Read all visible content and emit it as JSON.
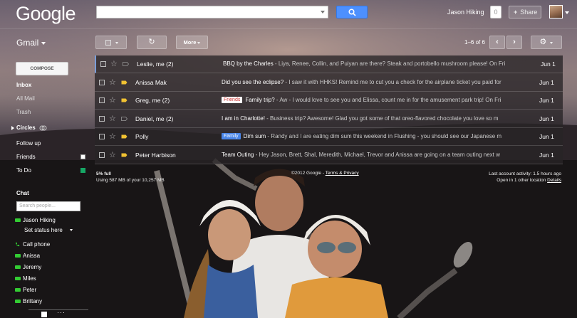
{
  "app": {
    "logo": "Google",
    "product": "Gmail"
  },
  "header": {
    "search": {
      "value": "",
      "placeholder": ""
    },
    "user_name": "Jason Hiking",
    "notifications_count": "0",
    "share_label": "Share",
    "share_plus": "+"
  },
  "toolbar": {
    "more_label": "More",
    "pager": "1–6 of 6",
    "prev_glyph": "‹",
    "next_glyph": "›",
    "refresh_glyph": "↻",
    "settings_glyph": "⚙"
  },
  "nav": {
    "compose_label": "COMPOSE",
    "items": [
      {
        "label": "Inbox"
      },
      {
        "label": "All Mail"
      },
      {
        "label": "Trash"
      },
      {
        "label": "Circles"
      },
      {
        "label": "Follow up"
      },
      {
        "label": "Friends"
      },
      {
        "label": "To Do"
      }
    ],
    "label_colors": {
      "friends": "#ffffff",
      "todo": "#16a765"
    }
  },
  "chat": {
    "title": "Chat",
    "search_placeholder": "Search people...",
    "self_name": "Jason Hiking",
    "status": "Set status here",
    "call_phone": "Call phone",
    "contacts": [
      "Anissa",
      "Jeremy",
      "Miles",
      "Peter",
      "Brittany"
    ]
  },
  "messages": [
    {
      "sender": "Leslie, me (2)",
      "tag": "",
      "subject": "BBQ by the Charles",
      "snippet": " - Liya, Renee, Collin, and Puiyan are there? Steak and portobello mushroom please! On Fri",
      "date": "Jun 1",
      "important": false
    },
    {
      "sender": "Anissa Mak",
      "tag": "",
      "subject": "Did you see the eclipse?",
      "snippet": " - I saw it with HHKS! Remind me to cut you a check for the airplane ticket you paid for",
      "date": "Jun 1",
      "important": true
    },
    {
      "sender": "Greg, me (2)",
      "tag": "Friends",
      "subject": "Family trip?",
      "snippet": " - Aw - I would love to see you and Elissa, count me in for the amusement park trip! On Fri",
      "date": "Jun 1",
      "important": true
    },
    {
      "sender": "Daniel, me (2)",
      "tag": "",
      "subject": "I am in Charlotte!",
      "snippet": " - Business trip? Awesome! Glad you got some of that oreo-flavored chocolate you love so m",
      "date": "Jun 1",
      "important": false
    },
    {
      "sender": "Polly",
      "tag": "Family",
      "subject": "Dim sum",
      "snippet": " - Randy and I are eating dim sum this weekend in Flushing - you should see our Japanese m",
      "date": "Jun 1",
      "important": true
    },
    {
      "sender": "Peter Harbison",
      "tag": "",
      "subject": "Team Outing",
      "snippet": " - Hey Jason, Brett, Shal, Meredith, Michael, Trevor and Anissa are going on a team outing next w",
      "date": "Jun 1",
      "important": true
    }
  ],
  "footer": {
    "quota_percent": "5% full",
    "quota_detail": "Using 587 MB of your 10,257 MB",
    "copyright": "©2012 Google - ",
    "terms": "Terms & Privacy",
    "activity": "Last account activity: 1.5 hours ago",
    "other_location": "Open in 1 other location ",
    "details": "Details"
  },
  "colors": {
    "search_blue": "#4d90fe",
    "important_yellow": "#f1c232",
    "friends_tag_text": "#cc3333",
    "family_tag_bg": "#4a86e8"
  }
}
